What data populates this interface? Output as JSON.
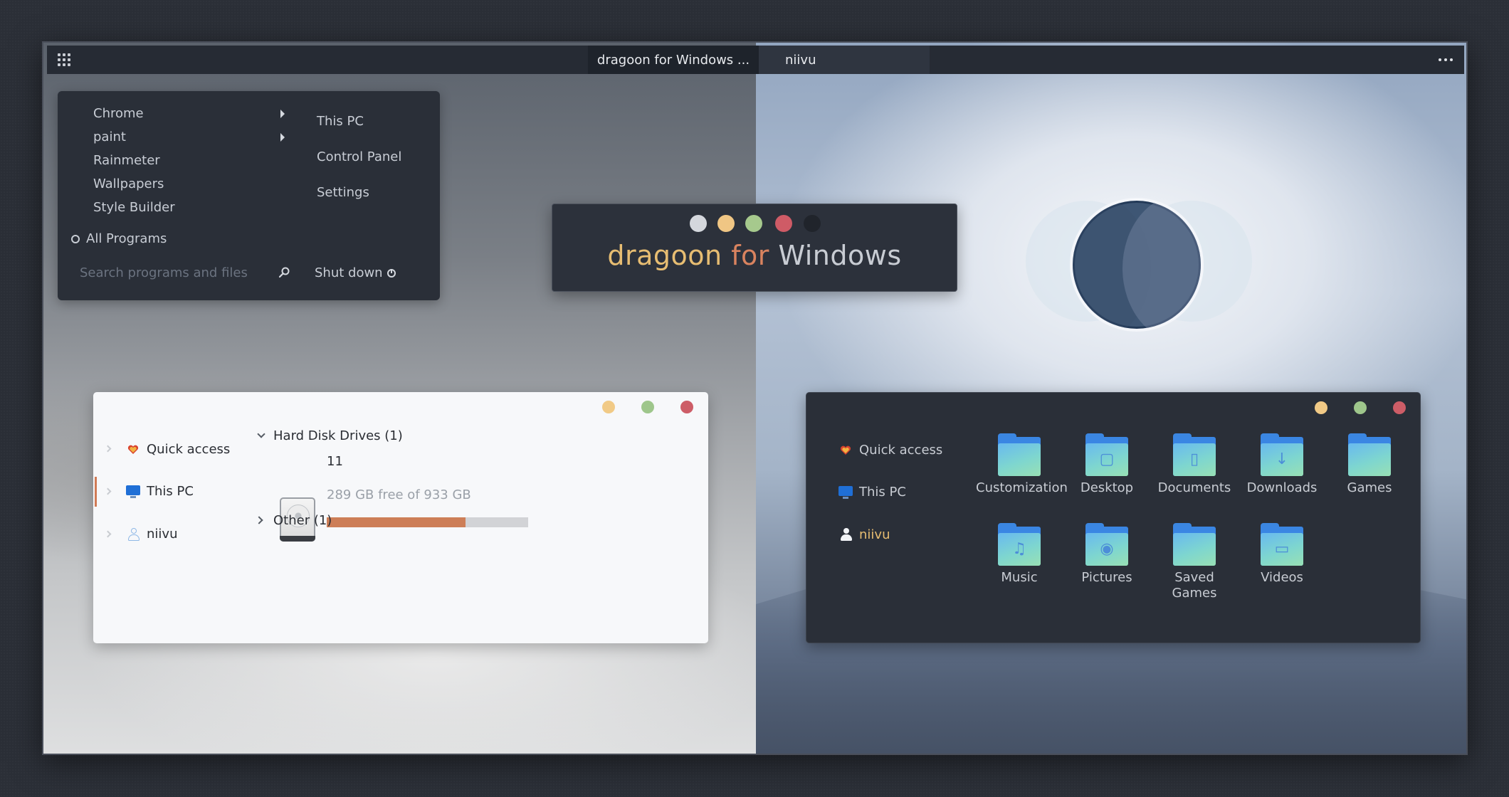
{
  "topbar": {
    "tabs": [
      {
        "label": "dragoon for Windows ..."
      },
      {
        "label": "niivu"
      }
    ]
  },
  "start_menu": {
    "programs": [
      {
        "label": "Chrome",
        "has_submenu": true
      },
      {
        "label": "paint",
        "has_submenu": true
      },
      {
        "label": "Rainmeter"
      },
      {
        "label": "Wallpapers"
      },
      {
        "label": "Style Builder"
      }
    ],
    "all_programs": "All Programs",
    "places": [
      "This PC",
      "Control Panel",
      "Settings"
    ],
    "search_placeholder": "Search programs and files",
    "shutdown_label": "Shut down"
  },
  "logo": {
    "swatches": [
      "#d4d7dd",
      "#f0c684",
      "#a6c98d",
      "#cf5b66",
      "#20242b"
    ],
    "word1": "dragoon",
    "word2": "for",
    "word3": "Windows",
    "colors": {
      "word1": "#e7bd72",
      "word2": "#d9835f",
      "word3": "#c8ccd3"
    }
  },
  "explorer_light": {
    "controls": [
      "#f1ca86",
      "#9ec68b",
      "#cd5d67"
    ],
    "nav": [
      {
        "label": "Quick access",
        "icon": "heart-icon"
      },
      {
        "label": "This PC",
        "icon": "pc-icon",
        "active": true
      },
      {
        "label": "niivu",
        "icon": "user-icon"
      }
    ],
    "section_drives": "Hard Disk Drives (1)",
    "drive": {
      "name": "11",
      "used_fraction": 0.69,
      "free_text": "289 GB free of 933 GB"
    },
    "section_other": "Other (1)"
  },
  "explorer_dark": {
    "controls": [
      "#f1ca86",
      "#9ec68b",
      "#cd5d67"
    ],
    "nav": [
      {
        "label": "Quick access",
        "icon": "heart-icon"
      },
      {
        "label": "This PC",
        "icon": "pc-icon"
      },
      {
        "label": "niivu",
        "icon": "user-icon",
        "active": true
      }
    ],
    "folders": [
      {
        "label": "Customization",
        "glyph": ""
      },
      {
        "label": "Desktop",
        "glyph": "▢"
      },
      {
        "label": "Documents",
        "glyph": "▯"
      },
      {
        "label": "Downloads",
        "glyph": "↓"
      },
      {
        "label": "Games",
        "glyph": ""
      },
      {
        "label": "Music",
        "glyph": "♫"
      },
      {
        "label": "Pictures",
        "glyph": "◉"
      },
      {
        "label": "Saved Games",
        "glyph": ""
      },
      {
        "label": "Videos",
        "glyph": "▭"
      }
    ],
    "accent_user": "#e7bd72"
  }
}
